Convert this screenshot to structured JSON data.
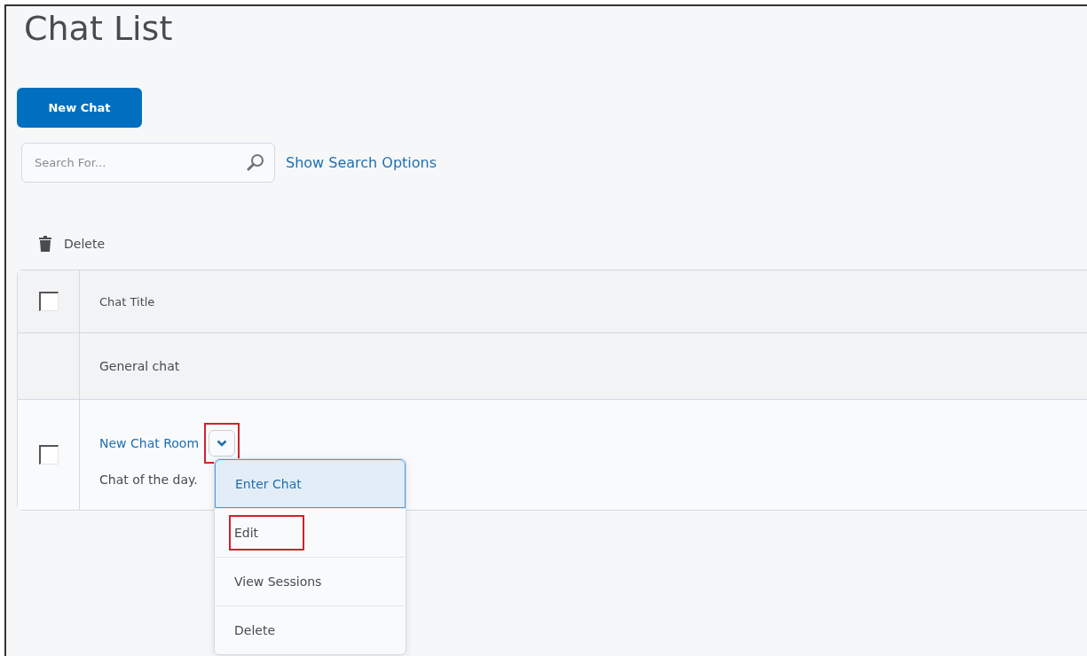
{
  "page": {
    "title": "Chat List"
  },
  "new_chat_button": {
    "label": "New Chat"
  },
  "search": {
    "placeholder": "Search For...",
    "options_link": "Show Search Options"
  },
  "toolbar": {
    "delete_label": "Delete"
  },
  "table": {
    "select_all_checked": false,
    "columns": [
      "Chat Title"
    ],
    "rows": [
      {
        "kind": "group",
        "title": "General chat"
      },
      {
        "kind": "item",
        "title": "New Chat Room",
        "description": "Chat of the day.",
        "checked": false,
        "menu_button_highlighted": true,
        "menu_open": true,
        "menu": [
          {
            "label": "Enter Chat",
            "selected": true,
            "highlighted": false
          },
          {
            "label": "Edit",
            "selected": false,
            "highlighted": true
          },
          {
            "label": "View Sessions",
            "selected": false,
            "highlighted": false
          },
          {
            "label": "Delete",
            "selected": false,
            "highlighted": false
          }
        ]
      }
    ]
  }
}
